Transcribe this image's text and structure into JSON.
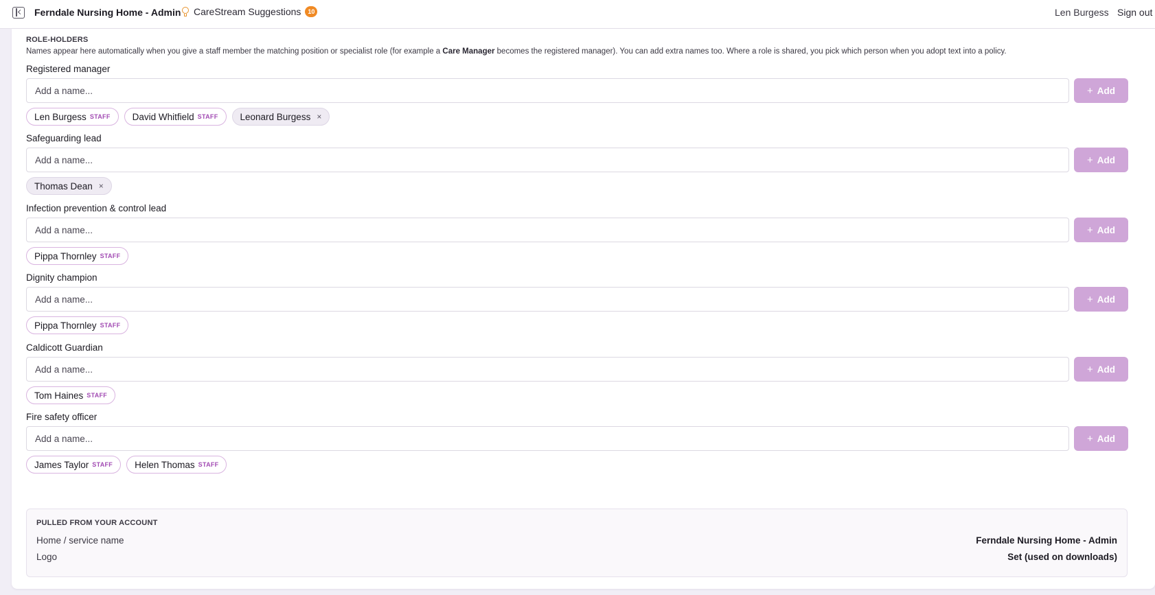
{
  "topbar": {
    "title": "Ferndale Nursing Home - Admin",
    "suggestions_label": "CareStream Suggestions",
    "suggestions_count": "10",
    "user_name": "Len Burgess",
    "signout_label": "Sign out"
  },
  "section": {
    "heading": "ROLE-HOLDERS",
    "desc_before": "Names appear here automatically when you give a staff member the matching position or specialist role (for example a ",
    "desc_bold": "Care Manager",
    "desc_after": " becomes the registered manager). You can add extra names too. Where a role is shared, you pick which person when you adopt text into a policy."
  },
  "input_placeholder": "Add a name...",
  "add_label": "Add",
  "staff_tag": "STAFF",
  "roles": [
    {
      "label": "Registered manager",
      "chips": [
        {
          "name": "Len Burgess",
          "type": "staff"
        },
        {
          "name": "David Whitfield",
          "type": "staff"
        },
        {
          "name": "Leonard Burgess",
          "type": "manual"
        }
      ]
    },
    {
      "label": "Safeguarding lead",
      "chips": [
        {
          "name": "Thomas Dean",
          "type": "manual"
        }
      ]
    },
    {
      "label": "Infection prevention & control lead",
      "chips": [
        {
          "name": "Pippa Thornley",
          "type": "staff"
        }
      ]
    },
    {
      "label": "Dignity champion",
      "chips": [
        {
          "name": "Pippa Thornley",
          "type": "staff"
        }
      ]
    },
    {
      "label": "Caldicott Guardian",
      "chips": [
        {
          "name": "Tom Haines",
          "type": "staff"
        }
      ]
    },
    {
      "label": "Fire safety officer",
      "chips": [
        {
          "name": "James Taylor",
          "type": "staff"
        },
        {
          "name": "Helen Thomas",
          "type": "staff"
        }
      ]
    }
  ],
  "account": {
    "heading": "PULLED FROM YOUR ACCOUNT",
    "rows": [
      {
        "key": "Home / service name",
        "value": "Ferndale Nursing Home - Admin"
      },
      {
        "key": "Logo",
        "value": "Set (used on downloads)"
      }
    ]
  },
  "colors": {
    "accent": "#cfa6d8",
    "staff_tag": "#a24bb3",
    "badge": "#f08a24",
    "bulb": "#e8942e"
  },
  "icons": {
    "sidebar_toggle": "sidebar-toggle-icon",
    "suggestions": "lightbulb-icon",
    "add": "plus-icon",
    "remove": "close-icon"
  }
}
